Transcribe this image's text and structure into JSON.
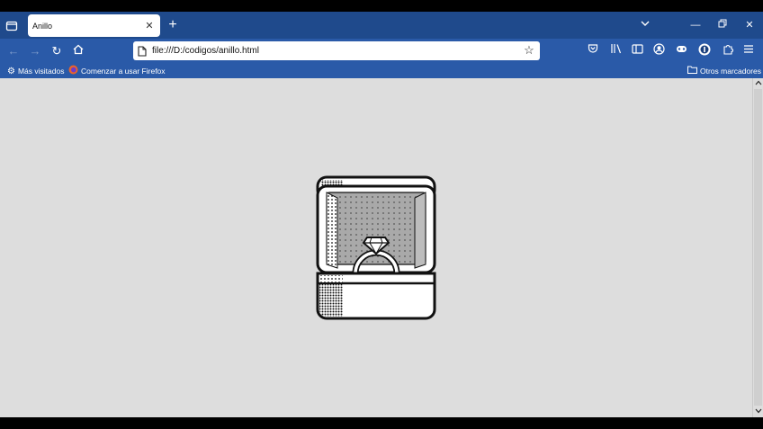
{
  "tab": {
    "title": "Anillo"
  },
  "address": {
    "url": "file:///D:/codigos/anillo.html"
  },
  "bookmarks": {
    "most_visited": "Más visitados",
    "getting_started": "Comenzar a usar Firefox",
    "other": "Otros marcadores"
  },
  "content": {
    "background": "#dddddd",
    "image": "ring-box-icon"
  },
  "colors": {
    "tabstrip": "#1f4a8c",
    "toolbar": "#2a5aa8"
  }
}
